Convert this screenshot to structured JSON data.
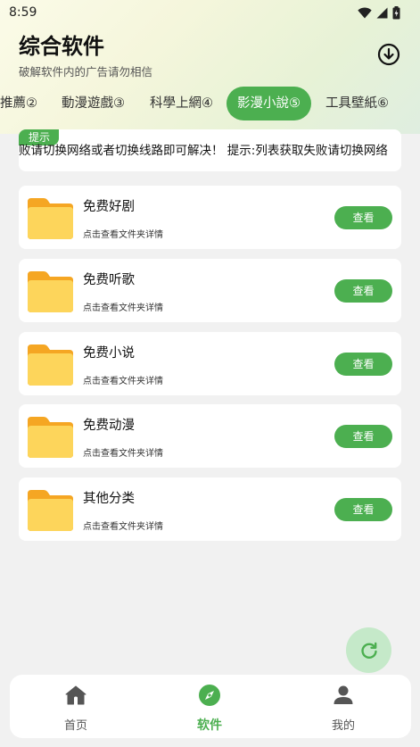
{
  "status_bar": {
    "time": "8:59"
  },
  "header": {
    "title": "综合软件",
    "subtitle": "破解软件内的广告请勿相信"
  },
  "tabs": [
    {
      "label": "推薦②",
      "active": false
    },
    {
      "label": "動漫遊戲③",
      "active": false
    },
    {
      "label": "科學上網④",
      "active": false
    },
    {
      "label": "影漫小說⑤",
      "active": true
    },
    {
      "label": "工具壁紙⑥",
      "active": false
    }
  ],
  "notice": {
    "badge": "提示",
    "text": "败请切换网络或者切换线路即可解决！    提示:列表获取失败请切换网络"
  },
  "list": [
    {
      "title": "免费好剧",
      "subtitle": "点击查看文件夹详情",
      "button": "查看"
    },
    {
      "title": "免费听歌",
      "subtitle": "点击查看文件夹详情",
      "button": "查看"
    },
    {
      "title": "免费小说",
      "subtitle": "点击查看文件夹详情",
      "button": "查看"
    },
    {
      "title": "免费动漫",
      "subtitle": "点击查看文件夹详情",
      "button": "查看"
    },
    {
      "title": "其他分类",
      "subtitle": "点击查看文件夹详情",
      "button": "查看"
    }
  ],
  "bottom_nav": [
    {
      "label": "首页",
      "icon": "home-icon",
      "active": false
    },
    {
      "label": "软件",
      "icon": "compass-icon",
      "active": true
    },
    {
      "label": "我的",
      "icon": "user-icon",
      "active": false
    }
  ],
  "colors": {
    "accent": "#4caf50",
    "folder_front": "#fdd55b",
    "folder_back": "#f5a623",
    "fab_bg": "#c5e9c9"
  }
}
